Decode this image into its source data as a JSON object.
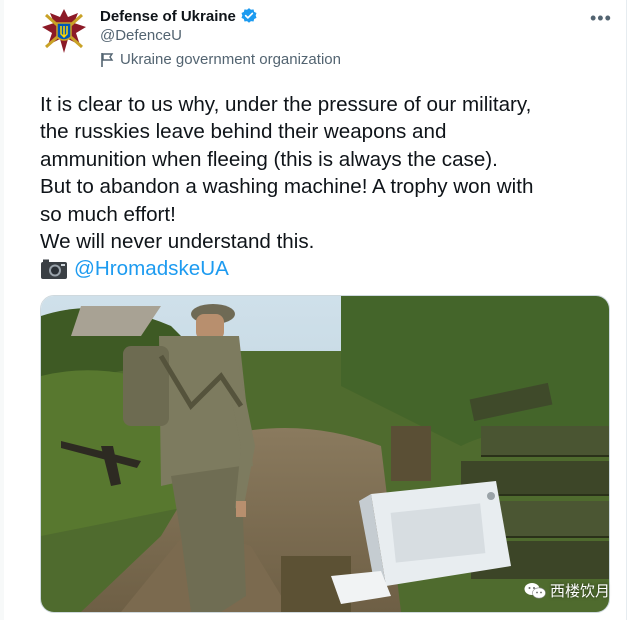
{
  "account": {
    "display_name": "Defense of Ukraine",
    "handle": "@DefenceU",
    "label": "Ukraine government organization"
  },
  "tweet": {
    "lines": [
      "It is clear to us why, under the pressure of our military,",
      "the russkies leave behind their weapons and",
      "ammunition when fleeing (this is always the case).",
      "But to abandon a washing machine! A trophy won with",
      "so much effort!",
      "We will never understand this."
    ],
    "mention": "@HromadskeUA"
  },
  "watermark": {
    "text": "西楼饮月"
  },
  "colors": {
    "accent": "#1d9bf0",
    "text": "#0f1419",
    "muted": "#536471",
    "emblem": "#8c1a27"
  },
  "icons": [
    "coat-of-arms-avatar-icon",
    "verified-badge-icon",
    "flag-icon",
    "more-options-icon",
    "camera-icon",
    "wechat-icon"
  ]
}
